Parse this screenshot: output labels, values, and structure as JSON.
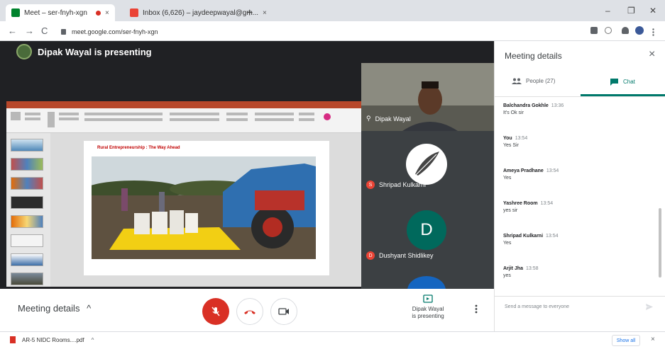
{
  "browser": {
    "tabs": [
      {
        "label": "Meet – ser-fnyh-xgn",
        "favicon_color": "#00832d",
        "recording": true
      },
      {
        "label": "Inbox (6,626) – jaydeepwayal@gm...",
        "favicon_color": "#ea4335"
      }
    ],
    "tab_close": "×",
    "new_tab": "+",
    "window_controls": [
      "–",
      "❐",
      "✕"
    ],
    "nav": {
      "back": "←",
      "forward": "→",
      "reload": "C"
    },
    "url": "meet.google.com/ser-fnyh-xgn"
  },
  "meet": {
    "presenter_banner": "Dipak Wayal is presenting",
    "slide": {
      "title": "Rural Entrepreneurship : The Way Ahead"
    },
    "tiles": [
      {
        "name": "Dipak Wayal",
        "type": "video"
      },
      {
        "name": "Shripad Kulkarni",
        "type": "logo",
        "initial": "S"
      },
      {
        "name": "Dushyant Shidlikey",
        "type": "initial",
        "initial": "D",
        "avatar_letter": "D",
        "avatar_color": "#00695c"
      }
    ],
    "bottom": {
      "meeting_details": "Meeting details",
      "caret": "^",
      "present_label_1": "Dipak Wayal",
      "present_label_2": "is presenting"
    },
    "colors": {
      "mic_off": "#d93025",
      "end_call": "#d93025",
      "accent": "#00796b"
    }
  },
  "panel": {
    "title": "Meeting details",
    "close": "×",
    "tabs": [
      {
        "label": "People (27)",
        "icon": "people-icon"
      },
      {
        "label": "Chat",
        "icon": "chat-icon",
        "active": true
      }
    ],
    "messages": [
      {
        "sender": "Balchandra Gokhle",
        "time": "13:36",
        "text": "It's Ok sir"
      },
      {
        "sender": "You",
        "time": "13:54",
        "text": "Yes Sir"
      },
      {
        "sender": "Ameya Pradhane",
        "time": "13:54",
        "text": "Yes"
      },
      {
        "sender": "Yashree Room",
        "time": "13:54",
        "text": "yes sir"
      },
      {
        "sender": "Shripad Kulkarni",
        "time": "13:54",
        "text": "Yes"
      },
      {
        "sender": "Arjit Jha",
        "time": "13:58",
        "text": "yes"
      }
    ],
    "input_placeholder": "Send a message to everyone"
  },
  "downloads": {
    "item": "AR-5 NIDC Rooms....pdf",
    "item_caret": "^",
    "show_all": "Show all",
    "close": "×"
  }
}
